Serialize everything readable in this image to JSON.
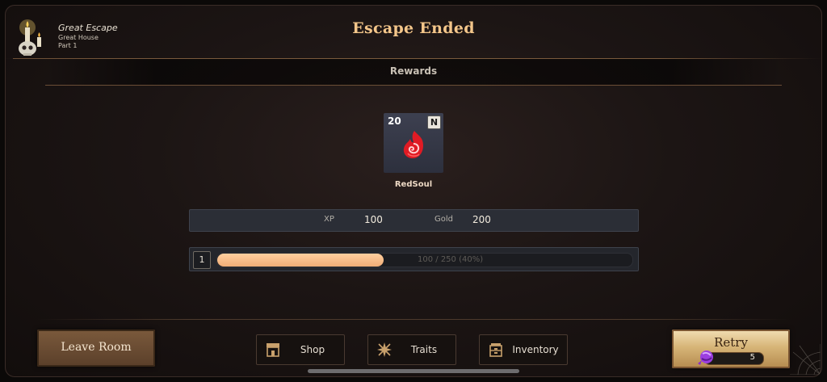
{
  "location": {
    "title": "Great Escape",
    "subtitle": "Great House",
    "part": "Part 1",
    "icon": "skull-candle-icon"
  },
  "title": "Escape Ended",
  "rewards": {
    "header": "Rewards",
    "items": [
      {
        "name": "RedSoul",
        "quantity": "20",
        "rarity": "N",
        "icon": "red-soul-icon",
        "bg_color": "#353846"
      }
    ]
  },
  "stats": {
    "xp_label": "XP",
    "xp_value": "100",
    "gold_label": "Gold",
    "gold_value": "200"
  },
  "level": {
    "current": "1",
    "progress_text": "100 / 250 (40%)",
    "progress_fraction": 0.4
  },
  "buttons": {
    "leave": "Leave Room",
    "shop": "Shop",
    "traits": "Traits",
    "inventory": "Inventory",
    "retry": "Retry",
    "retry_cost": "5"
  },
  "colors": {
    "title": "#f3c68a",
    "progress_fill": "#f0ad76",
    "retry_bg": "#d7b578",
    "leave_bg": "#6a4b32"
  }
}
